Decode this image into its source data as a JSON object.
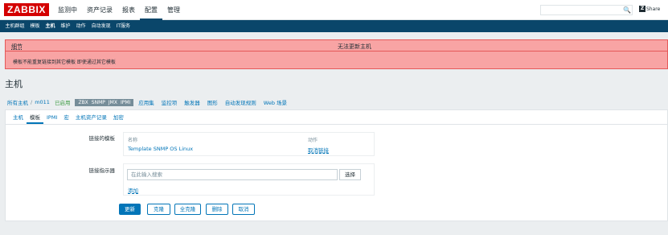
{
  "logo": "ZABBIX",
  "main_nav": [
    {
      "label": "监测中",
      "active": false
    },
    {
      "label": "资产记录",
      "active": false
    },
    {
      "label": "报表",
      "active": false
    },
    {
      "label": "配置",
      "active": true
    },
    {
      "label": "管理",
      "active": false
    }
  ],
  "search": {
    "placeholder": "",
    "button": "🔍"
  },
  "share_label": "Share",
  "sub_nav": [
    {
      "label": "主机群组",
      "active": false
    },
    {
      "label": "模板",
      "active": false
    },
    {
      "label": "主机",
      "active": true
    },
    {
      "label": "维护",
      "active": false
    },
    {
      "label": "动作",
      "active": false
    },
    {
      "label": "自动发现",
      "active": false
    },
    {
      "label": "IT服务",
      "active": false
    }
  ],
  "alert": {
    "details": "细节",
    "title": "无法更新主机",
    "message": "模板不能重复链接到其它模板 即使通过其它模板"
  },
  "page_title": "主机",
  "breadcrumbs": {
    "all_hosts": "所有主机",
    "separator": "/",
    "host_name": "m011",
    "status": "已启用",
    "availability": [
      "ZBX",
      "SNMP",
      "JMX",
      "IPMI"
    ],
    "context_links": [
      "应用集",
      "监控项",
      "触发器",
      "图形",
      "自动发现规则",
      "Web 场景"
    ]
  },
  "tabs": [
    {
      "label": "主机",
      "active": false
    },
    {
      "label": "模板",
      "active": true
    },
    {
      "label": "IPMI",
      "active": false
    },
    {
      "label": "宏",
      "active": false
    },
    {
      "label": "主机资产记录",
      "active": false
    },
    {
      "label": "加密",
      "active": false
    }
  ],
  "linked_templates": {
    "label": "链接的模板",
    "col_name": "名称",
    "col_action": "动作",
    "rows": [
      {
        "name": "Template SNMP OS Linux",
        "action": "取消链接"
      }
    ]
  },
  "link_indicator": {
    "label": "链接指示器",
    "placeholder": "在此输入搜索",
    "select_button": "选择",
    "add_link": "添加"
  },
  "buttons": {
    "update": "更新",
    "clone": "克隆",
    "full_clone": "全克隆",
    "delete": "删除",
    "cancel": "取消"
  },
  "colors": {
    "brand_red": "#d40000",
    "nav_blue": "#0a466a",
    "link_blue": "#0275b8",
    "error_bg": "#f8a4a4",
    "enabled_green": "#429e47"
  }
}
